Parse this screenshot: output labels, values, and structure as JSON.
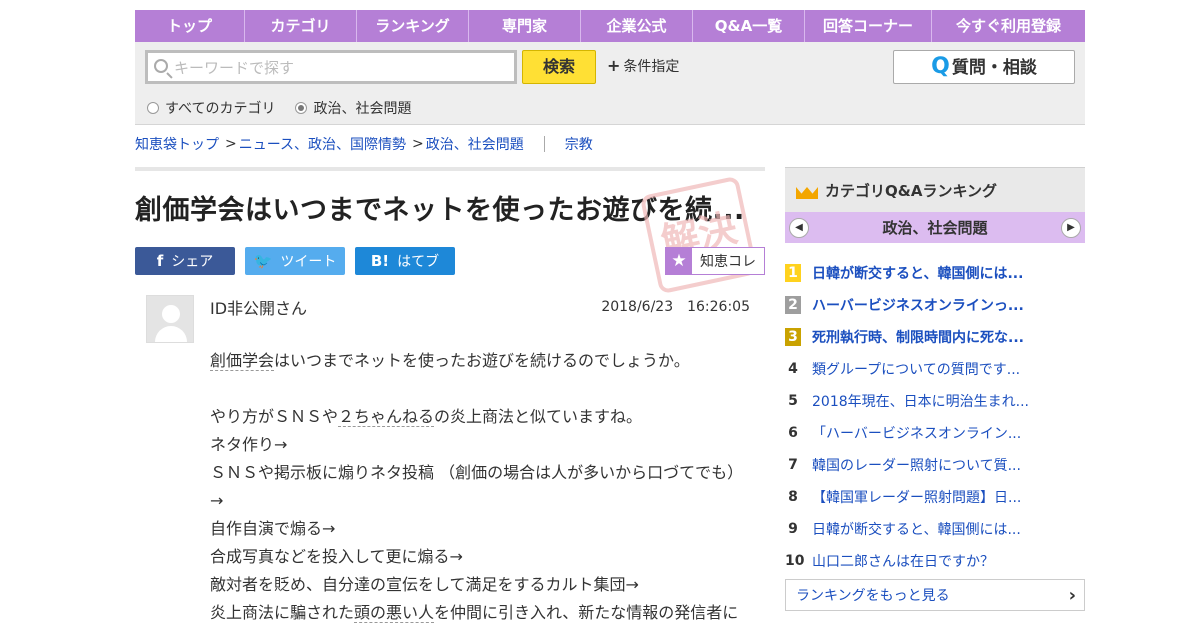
{
  "nav": [
    "トップ",
    "カテゴリ",
    "ランキング",
    "専門家",
    "企業公式",
    "Q&A一覧",
    "回答コーナー",
    "今すぐ利用登録"
  ],
  "search": {
    "placeholder": "キーワードで探す",
    "button": "検索",
    "condition": "条件指定",
    "ask_button": "質問・相談",
    "ask_prefix": "Q",
    "radios": [
      "すべてのカテゴリ",
      "政治、社会問題"
    ],
    "radio_selected": 1
  },
  "breadcrumb": {
    "items": [
      "知恵袋トップ",
      "ニュース、政治、国際情勢",
      "政治、社会問題"
    ],
    "sep": ">",
    "tag": "宗教"
  },
  "question": {
    "title": "創価学会はいつまでネットを使ったお遊びを続...",
    "stamp": "解決",
    "share": {
      "fb": "シェア",
      "tw": "ツイート",
      "hb": "はてブ",
      "fb_icon": "f",
      "hb_icon": "B!"
    },
    "collection": "知恵コレ",
    "user": "ID非公開さん",
    "date": "2018/6/23　16:26:05",
    "lines": {
      "l1a": "創価学会",
      "l1b": "はいつまでネットを使ったお遊びを続けるのでしょうか。",
      "l2a": "やり方がＳＮＳや",
      "l2b": "２ちゃんねる",
      "l2c": "の炎上商法と似ていますね。",
      "l3": "ネタ作り→",
      "l4": "ＳＮＳや掲示板に煽りネタ投稿 （創価の場合は人が多いから口づてでも）",
      "l5": "→",
      "l6": "自作自演で煽る→",
      "l7": "合成写真などを投入して更に煽る→",
      "l8": "敵対者を貶め、自分達の宣伝をして満足をするカルト集団→",
      "l9a": "炎上商法に騙された",
      "l9b": "頭の悪い人",
      "l9c": "を仲間に引き入れ、新たな情報の発信者に"
    }
  },
  "ranking": {
    "title": "カテゴリQ&Aランキング",
    "category": "政治、社会問題",
    "items": [
      {
        "num": "1",
        "text": "日韓が断交すると、韓国側には..."
      },
      {
        "num": "2",
        "text": "ハーバービジネスオンラインっ..."
      },
      {
        "num": "3",
        "text": "死刑執行時、制限時間内に死な..."
      },
      {
        "num": "4",
        "text": "類グループについての質問です..."
      },
      {
        "num": "5",
        "text": "2018年現在、日本に明治生まれ..."
      },
      {
        "num": "6",
        "text": "「ハーバービジネスオンライン..."
      },
      {
        "num": "7",
        "text": "韓国のレーダー照射について質..."
      },
      {
        "num": "8",
        "text": "【韓国軍レーダー照射問題】日..."
      },
      {
        "num": "9",
        "text": "日韓が断交すると、韓国側には..."
      },
      {
        "num": "10",
        "text": "山口二郎さんは在日ですか？"
      }
    ],
    "more": "ランキングをもっと見る"
  }
}
